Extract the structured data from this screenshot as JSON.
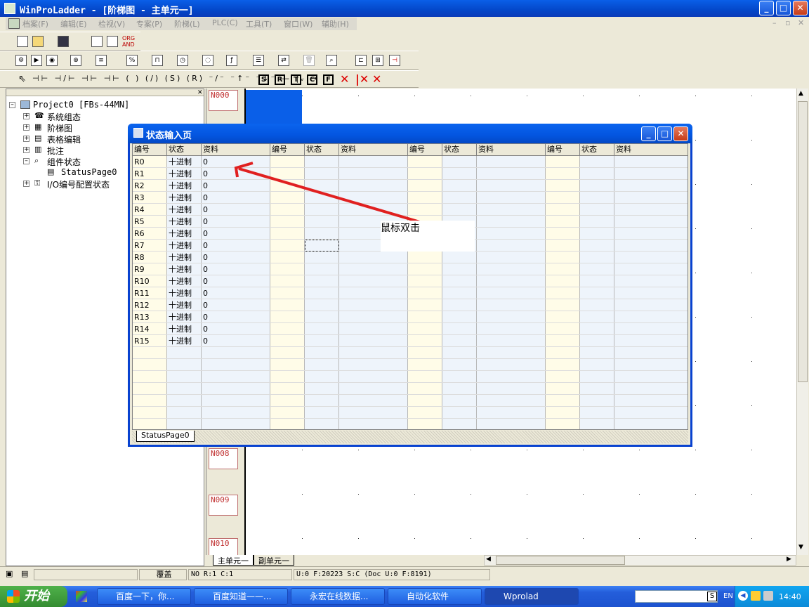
{
  "app": {
    "title": "WinProLadder - [阶梯图 - 主单元一]"
  },
  "menu": [
    "档案(F)",
    "编辑(E)",
    "检视(V)",
    "专案(P)",
    "阶梯(L)",
    "PLC(C)",
    "工具(T)",
    "窗口(W)",
    "辅助(H)"
  ],
  "toolbar3": {
    "s": "S",
    "r": "R",
    "t": "T",
    "c": "C",
    "f": "F"
  },
  "toolbar1": {
    "org_and": "ORG AND"
  },
  "tree": {
    "root": "Project0 [FBs-44MN]",
    "items": [
      "系统组态",
      "阶梯图",
      "表格编辑",
      "批注",
      "组件状态"
    ],
    "child": "StatusPage0",
    "last": "I/O编号配置状态"
  },
  "ladder": {
    "n000": "N000",
    "n008": "N008",
    "n009": "N009",
    "n010": "N010"
  },
  "dialog": {
    "title": "状态输入页",
    "headers": [
      "编号",
      "状态",
      "资料",
      "编号",
      "状态",
      "资料",
      "编号",
      "状态",
      "资料",
      "编号",
      "状态",
      "资料"
    ],
    "rows": [
      {
        "id": "R0",
        "state": "十进制",
        "value": "0"
      },
      {
        "id": "R1",
        "state": "十进制",
        "value": "0"
      },
      {
        "id": "R2",
        "state": "十进制",
        "value": "0"
      },
      {
        "id": "R3",
        "state": "十进制",
        "value": "0"
      },
      {
        "id": "R4",
        "state": "十进制",
        "value": "0"
      },
      {
        "id": "R5",
        "state": "十进制",
        "value": "0"
      },
      {
        "id": "R6",
        "state": "十进制",
        "value": "0"
      },
      {
        "id": "R7",
        "state": "十进制",
        "value": "0"
      },
      {
        "id": "R8",
        "state": "十进制",
        "value": "0"
      },
      {
        "id": "R9",
        "state": "十进制",
        "value": "0"
      },
      {
        "id": "R10",
        "state": "十进制",
        "value": "0"
      },
      {
        "id": "R11",
        "state": "十进制",
        "value": "0"
      },
      {
        "id": "R12",
        "state": "十进制",
        "value": "0"
      },
      {
        "id": "R13",
        "state": "十进制",
        "value": "0"
      },
      {
        "id": "R14",
        "state": "十进制",
        "value": "0"
      },
      {
        "id": "R15",
        "state": "十进制",
        "value": "0"
      }
    ],
    "tab": "StatusPage0"
  },
  "annotation": {
    "text": "鼠标双击"
  },
  "sheet_tabs": [
    "主单元一",
    "副单元一"
  ],
  "status": {
    "mode": "覆盖",
    "cursor": "NO R:1 C:1",
    "info": "U:0 F:20223 S:C (Doc U:0 F:8191)"
  },
  "taskbar": {
    "start": "开始",
    "tasks": [
      "百度一下，你...",
      "百度知道——...",
      "永宏在线数据...",
      "自动化软件",
      "Wprolad"
    ],
    "lang": "EN",
    "search_s": "S",
    "clock": "14:40"
  },
  "colors": {
    "accent": "#0842d0",
    "id_col": "#fffce8",
    "data_col": "#eef4fb",
    "arrow": "#e02020"
  }
}
